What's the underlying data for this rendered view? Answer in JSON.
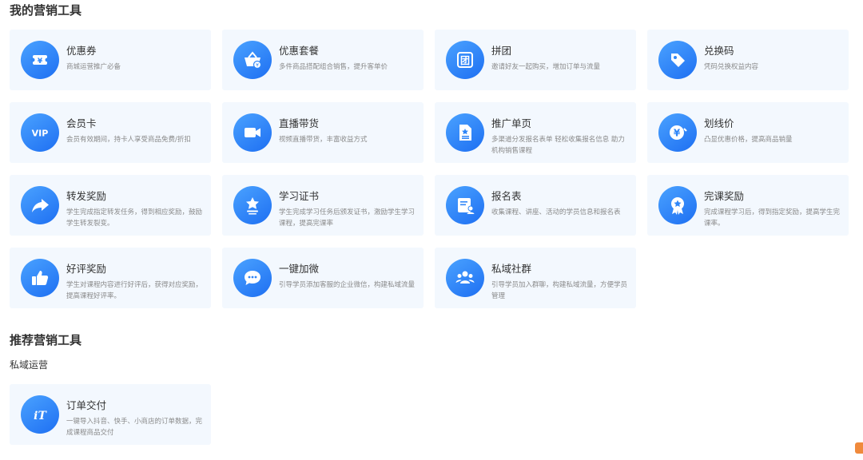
{
  "sections": {
    "my_tools_title": "我的营销工具",
    "recommended_title": "推荐营销工具",
    "private_domain_subtitle": "私域运营"
  },
  "my_tools": [
    {
      "name": "优惠券",
      "desc": "商城运营推广必备",
      "icon": "coupon-icon"
    },
    {
      "name": "优惠套餐",
      "desc": "多件商品搭配组合销售，提升客单价",
      "icon": "basket-icon"
    },
    {
      "name": "拼团",
      "desc": "邀请好友一起购买，增加订单与流量",
      "icon": "group-buy-icon"
    },
    {
      "name": "兑换码",
      "desc": "凭码兑换权益内容",
      "icon": "tag-icon"
    },
    {
      "name": "会员卡",
      "desc": "会员有效期间，持卡人享受商品免费/折扣",
      "icon": "vip-icon"
    },
    {
      "name": "直播带货",
      "desc": "视频直播带货，丰富收益方式",
      "icon": "video-camera-icon"
    },
    {
      "name": "推广单页",
      "desc": "多渠道分发报名表单 轻松收集报名信息 助力机构销售课程",
      "icon": "document-icon"
    },
    {
      "name": "划线价",
      "desc": "凸显优惠价格，提高商品销量",
      "icon": "yen-icon"
    },
    {
      "name": "转发奖励",
      "desc": "学生完成指定转发任务，得到相应奖励，鼓励学生转发裂变。",
      "icon": "share-arrow-icon"
    },
    {
      "name": "学习证书",
      "desc": "学生完成学习任务后颁发证书，激励学生学习课程，提高完课率",
      "icon": "certificate-icon"
    },
    {
      "name": "报名表",
      "desc": "收集课程、讲座、活动的学员信息和报名表",
      "icon": "form-icon"
    },
    {
      "name": "完课奖励",
      "desc": "完成课程学习后，得到指定奖励，提高学生完课率。",
      "icon": "medal-icon"
    },
    {
      "name": "好评奖励",
      "desc": "学生对课程内容进行好评后，获得对应奖励，提高课程好评率。",
      "icon": "thumbs-up-icon"
    },
    {
      "name": "一键加微",
      "desc": "引导学员添加客服的企业微信，构建私域流量",
      "icon": "chat-bubble-icon"
    },
    {
      "name": "私域社群",
      "desc": "引导学员加入群聊，构建私域流量，方便学员管理",
      "icon": "community-icon"
    }
  ],
  "recommended_tools": [
    {
      "name": "订单交付",
      "desc": "一键导入抖音、快手、小商店的订单数据，完成课程商品交付",
      "icon": "order-delivery-icon"
    }
  ]
}
